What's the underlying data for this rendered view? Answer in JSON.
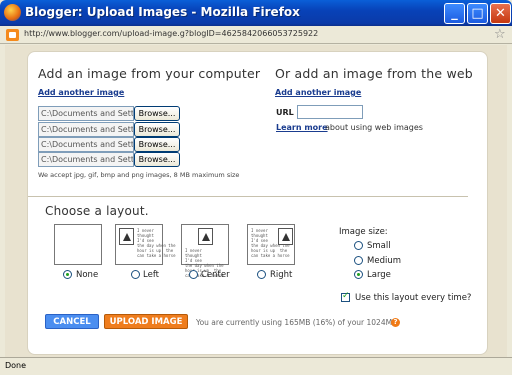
{
  "window": {
    "title": "Blogger: Upload Images - Mozilla Firefox",
    "min_icon": "minimize-icon",
    "max_icon": "maximize-icon",
    "close_icon": "close-icon"
  },
  "address": {
    "url": "http://www.blogger.com/upload-image.g?blogID=4625842066053725922"
  },
  "left_section": {
    "heading": "Add an image from your computer",
    "add_another": "Add another image",
    "files": [
      {
        "path": "C:\\Documents and Setti",
        "button": "Browse..."
      },
      {
        "path": "C:\\Documents and Setti",
        "button": "Browse..."
      },
      {
        "path": "C:\\Documents and Setti",
        "button": "Browse..."
      },
      {
        "path": "C:\\Documents and Setti",
        "button": "Browse..."
      }
    ],
    "note": "We accept jpg, gif, bmp and png images, 8 MB maximum size"
  },
  "right_section": {
    "heading": "Or add an image from the web",
    "add_another": "Add another image",
    "url_label": "URL",
    "url_value": "",
    "learn_more": "Learn more",
    "learn_more_suffix": "about using web images"
  },
  "layout": {
    "heading": "Choose a layout.",
    "thumb_text": "I never\nthought\nI'd see\nthe day when the\nhour is up  the\ncan take a horse",
    "options": [
      {
        "label": "None",
        "selected": true
      },
      {
        "label": "Left",
        "selected": false
      },
      {
        "label": "Center",
        "selected": false
      },
      {
        "label": "Right",
        "selected": false
      }
    ]
  },
  "image_size": {
    "label": "Image size:",
    "options": [
      {
        "label": "Small",
        "selected": false
      },
      {
        "label": "Medium",
        "selected": false
      },
      {
        "label": "Large",
        "selected": true
      }
    ]
  },
  "remember": {
    "label": "Use this layout every time?",
    "checked": true
  },
  "actions": {
    "cancel": "CANCEL",
    "upload": "UPLOAD IMAGE"
  },
  "usage": {
    "text": "You are currently using 165MB (16%) of your 1024MB",
    "help": "?"
  },
  "status": {
    "text": "Done"
  },
  "colors": {
    "link": "#1a3c8f",
    "cancel_button": "#4b8ef0",
    "upload_button": "#ef7d1e",
    "selected_radio": "#21a121"
  }
}
